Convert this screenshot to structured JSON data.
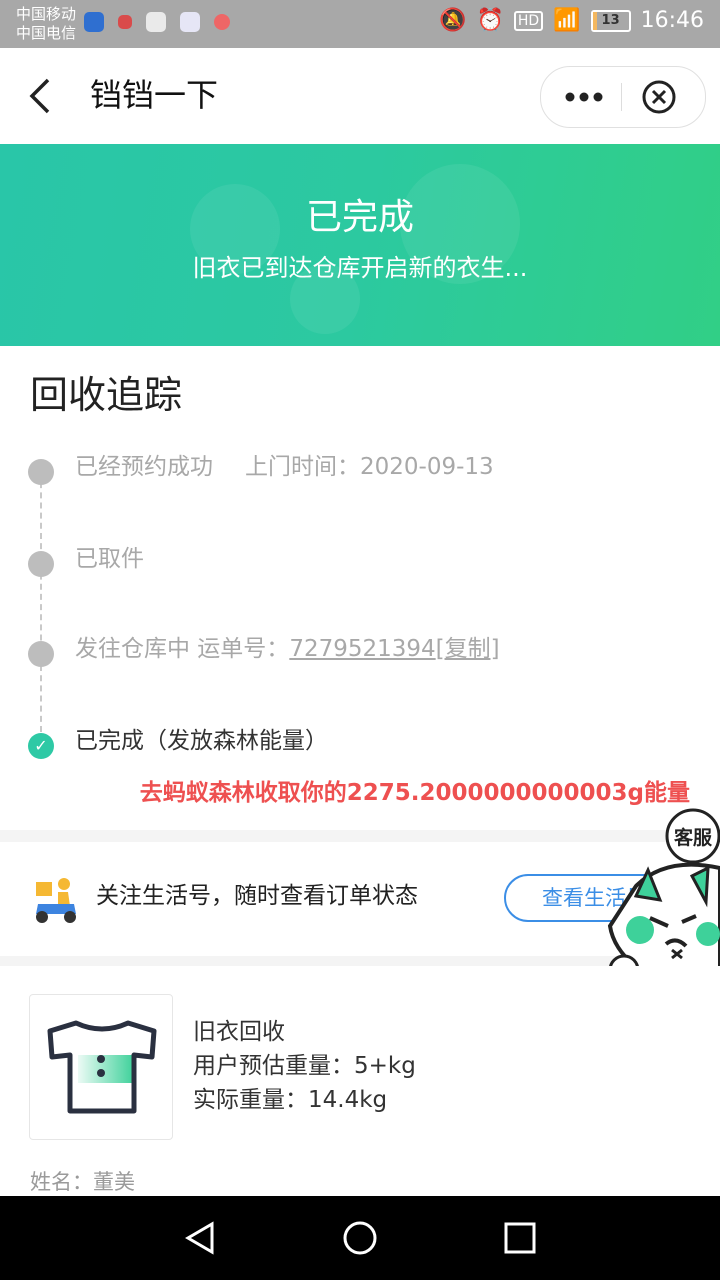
{
  "status_bar": {
    "carrier_1": "中国移动",
    "carrier_2": "中国电信",
    "network": "HD",
    "battery": "13",
    "time": "16:46"
  },
  "navbar": {
    "back_icon": "chevron-left-icon",
    "title": "铛铛一下",
    "more_icon": "more-icon",
    "close_icon": "close-circle-icon"
  },
  "banner": {
    "title": "已完成",
    "subtitle": "旧衣已到达仓库开启新的衣生..."
  },
  "tracking": {
    "title": "回收追踪",
    "steps": [
      {
        "label": "已经预约成功",
        "extra": "上门时间：2020-09-13"
      },
      {
        "label": "已取件"
      },
      {
        "label": "发往仓库中 运单号：",
        "tracking_number": "7279521394",
        "copy": "[复制]"
      },
      {
        "label": "已完成（发放森林能量）"
      }
    ],
    "energy_link": "去蚂蚁森林收取你的2275.2000000000003g能量"
  },
  "follow": {
    "text": "关注生活号，随时查看订单状态",
    "button": "查看生活号",
    "service_label": "客服"
  },
  "product": {
    "name": "旧衣回收",
    "estimated_weight": "用户预估重量：5+kg",
    "actual_weight": "实际重量：14.4kg",
    "person": "姓名：董美"
  },
  "colors": {
    "accent": "#2cc9a0",
    "link_red": "#ee5050",
    "button_blue": "#3b8ee6"
  }
}
